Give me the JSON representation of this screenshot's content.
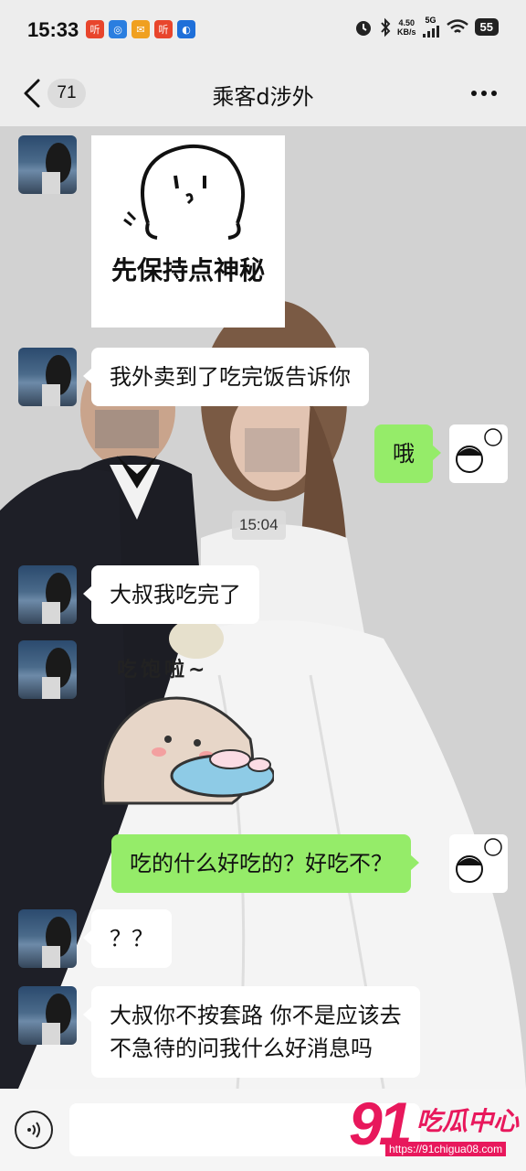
{
  "status_bar": {
    "time": "15:33",
    "notif_icons": [
      {
        "name": "listen-app-icon",
        "glyph": "听",
        "color": "#e8452c"
      },
      {
        "name": "browser-app-icon",
        "glyph": "◎",
        "color": "#2a7ee0"
      },
      {
        "name": "mail-app-icon",
        "glyph": "✉",
        "color": "#f0a020"
      },
      {
        "name": "listen-app-icon-2",
        "glyph": "听",
        "color": "#e8452c"
      },
      {
        "name": "blue-app-icon",
        "glyph": "◐",
        "color": "#1e6fd9"
      }
    ],
    "net_speed_value": "4.50",
    "net_speed_unit": "KB/s",
    "network": "5G",
    "battery": "55"
  },
  "nav": {
    "unread_count": "71",
    "title": "乘客d涉外"
  },
  "messages": [
    {
      "id": "sticker-1",
      "side": "left",
      "type": "sticker",
      "caption": "先保持点神秘"
    },
    {
      "id": "msg-1",
      "side": "left",
      "type": "text",
      "text": "我外卖到了吃完饭告诉你"
    },
    {
      "id": "msg-2",
      "side": "right",
      "type": "text",
      "text": "哦"
    },
    {
      "id": "time-1",
      "type": "time",
      "text": "15:04"
    },
    {
      "id": "msg-3",
      "side": "left",
      "type": "text",
      "text": "大叔我吃完了"
    },
    {
      "id": "sticker-2",
      "side": "left",
      "type": "sticker",
      "caption": "吃饱啦~"
    },
    {
      "id": "msg-4",
      "side": "right",
      "type": "text",
      "text": "吃的什么好吃的？好吃不？"
    },
    {
      "id": "msg-5",
      "side": "left",
      "type": "text",
      "text": "？？"
    },
    {
      "id": "msg-6",
      "side": "left",
      "type": "text",
      "line1": "大叔你不按套路 你不是应该去",
      "line2": "不急待的问我什么好消息吗"
    }
  ],
  "watermark": {
    "number": "91",
    "name": "吃瓜中心",
    "url": "https://91chigua08.com"
  },
  "colors": {
    "bubble_green": "#95ec69",
    "bubble_white": "#ffffff",
    "bar_bg": "#ededed",
    "watermark": "#e8185c"
  }
}
